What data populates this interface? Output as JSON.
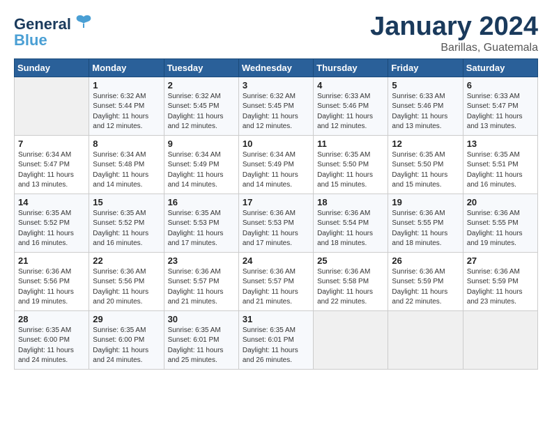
{
  "header": {
    "logo_general": "General",
    "logo_blue": "Blue",
    "title": "January 2024",
    "location": "Barillas, Guatemala"
  },
  "weekdays": [
    "Sunday",
    "Monday",
    "Tuesday",
    "Wednesday",
    "Thursday",
    "Friday",
    "Saturday"
  ],
  "weeks": [
    [
      {
        "day": "",
        "info": ""
      },
      {
        "day": "1",
        "info": "Sunrise: 6:32 AM\nSunset: 5:44 PM\nDaylight: 11 hours\nand 12 minutes."
      },
      {
        "day": "2",
        "info": "Sunrise: 6:32 AM\nSunset: 5:45 PM\nDaylight: 11 hours\nand 12 minutes."
      },
      {
        "day": "3",
        "info": "Sunrise: 6:32 AM\nSunset: 5:45 PM\nDaylight: 11 hours\nand 12 minutes."
      },
      {
        "day": "4",
        "info": "Sunrise: 6:33 AM\nSunset: 5:46 PM\nDaylight: 11 hours\nand 12 minutes."
      },
      {
        "day": "5",
        "info": "Sunrise: 6:33 AM\nSunset: 5:46 PM\nDaylight: 11 hours\nand 13 minutes."
      },
      {
        "day": "6",
        "info": "Sunrise: 6:33 AM\nSunset: 5:47 PM\nDaylight: 11 hours\nand 13 minutes."
      }
    ],
    [
      {
        "day": "7",
        "info": "Sunrise: 6:34 AM\nSunset: 5:47 PM\nDaylight: 11 hours\nand 13 minutes."
      },
      {
        "day": "8",
        "info": "Sunrise: 6:34 AM\nSunset: 5:48 PM\nDaylight: 11 hours\nand 14 minutes."
      },
      {
        "day": "9",
        "info": "Sunrise: 6:34 AM\nSunset: 5:49 PM\nDaylight: 11 hours\nand 14 minutes."
      },
      {
        "day": "10",
        "info": "Sunrise: 6:34 AM\nSunset: 5:49 PM\nDaylight: 11 hours\nand 14 minutes."
      },
      {
        "day": "11",
        "info": "Sunrise: 6:35 AM\nSunset: 5:50 PM\nDaylight: 11 hours\nand 15 minutes."
      },
      {
        "day": "12",
        "info": "Sunrise: 6:35 AM\nSunset: 5:50 PM\nDaylight: 11 hours\nand 15 minutes."
      },
      {
        "day": "13",
        "info": "Sunrise: 6:35 AM\nSunset: 5:51 PM\nDaylight: 11 hours\nand 16 minutes."
      }
    ],
    [
      {
        "day": "14",
        "info": "Sunrise: 6:35 AM\nSunset: 5:52 PM\nDaylight: 11 hours\nand 16 minutes."
      },
      {
        "day": "15",
        "info": "Sunrise: 6:35 AM\nSunset: 5:52 PM\nDaylight: 11 hours\nand 16 minutes."
      },
      {
        "day": "16",
        "info": "Sunrise: 6:35 AM\nSunset: 5:53 PM\nDaylight: 11 hours\nand 17 minutes."
      },
      {
        "day": "17",
        "info": "Sunrise: 6:36 AM\nSunset: 5:53 PM\nDaylight: 11 hours\nand 17 minutes."
      },
      {
        "day": "18",
        "info": "Sunrise: 6:36 AM\nSunset: 5:54 PM\nDaylight: 11 hours\nand 18 minutes."
      },
      {
        "day": "19",
        "info": "Sunrise: 6:36 AM\nSunset: 5:55 PM\nDaylight: 11 hours\nand 18 minutes."
      },
      {
        "day": "20",
        "info": "Sunrise: 6:36 AM\nSunset: 5:55 PM\nDaylight: 11 hours\nand 19 minutes."
      }
    ],
    [
      {
        "day": "21",
        "info": "Sunrise: 6:36 AM\nSunset: 5:56 PM\nDaylight: 11 hours\nand 19 minutes."
      },
      {
        "day": "22",
        "info": "Sunrise: 6:36 AM\nSunset: 5:56 PM\nDaylight: 11 hours\nand 20 minutes."
      },
      {
        "day": "23",
        "info": "Sunrise: 6:36 AM\nSunset: 5:57 PM\nDaylight: 11 hours\nand 21 minutes."
      },
      {
        "day": "24",
        "info": "Sunrise: 6:36 AM\nSunset: 5:57 PM\nDaylight: 11 hours\nand 21 minutes."
      },
      {
        "day": "25",
        "info": "Sunrise: 6:36 AM\nSunset: 5:58 PM\nDaylight: 11 hours\nand 22 minutes."
      },
      {
        "day": "26",
        "info": "Sunrise: 6:36 AM\nSunset: 5:59 PM\nDaylight: 11 hours\nand 22 minutes."
      },
      {
        "day": "27",
        "info": "Sunrise: 6:36 AM\nSunset: 5:59 PM\nDaylight: 11 hours\nand 23 minutes."
      }
    ],
    [
      {
        "day": "28",
        "info": "Sunrise: 6:35 AM\nSunset: 6:00 PM\nDaylight: 11 hours\nand 24 minutes."
      },
      {
        "day": "29",
        "info": "Sunrise: 6:35 AM\nSunset: 6:00 PM\nDaylight: 11 hours\nand 24 minutes."
      },
      {
        "day": "30",
        "info": "Sunrise: 6:35 AM\nSunset: 6:01 PM\nDaylight: 11 hours\nand 25 minutes."
      },
      {
        "day": "31",
        "info": "Sunrise: 6:35 AM\nSunset: 6:01 PM\nDaylight: 11 hours\nand 26 minutes."
      },
      {
        "day": "",
        "info": ""
      },
      {
        "day": "",
        "info": ""
      },
      {
        "day": "",
        "info": ""
      }
    ]
  ]
}
